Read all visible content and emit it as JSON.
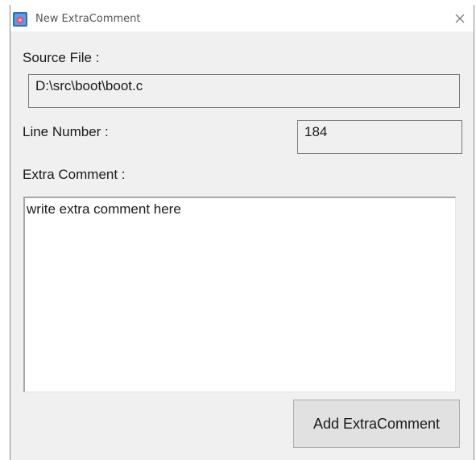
{
  "window": {
    "title": "New ExtraComment"
  },
  "form": {
    "source_file_label": "Source File :",
    "source_file_value": "D:\\src\\boot\\boot.c",
    "line_number_label": "Line Number :",
    "line_number_value": "184",
    "extra_comment_label": "Extra Comment :",
    "extra_comment_value": "write extra comment here"
  },
  "actions": {
    "add_label": "Add ExtraComment"
  },
  "icons": {
    "app": "app-icon",
    "close": "close-icon"
  },
  "colors": {
    "window_bg": "#f0f0f0",
    "button_bg": "#e1e1e1",
    "icon_blue": "#2f6fb8",
    "icon_pink": "#e0507a"
  }
}
